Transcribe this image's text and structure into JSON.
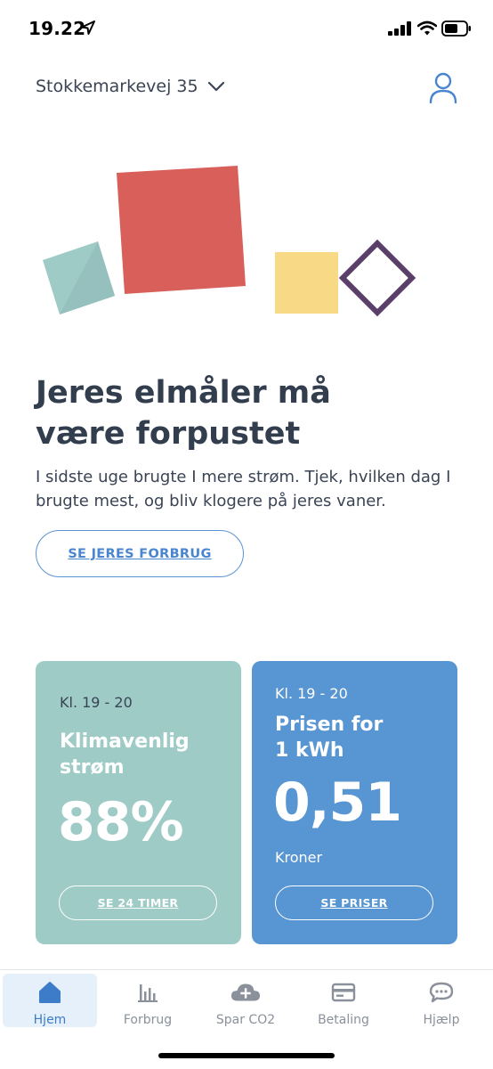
{
  "status_bar": {
    "time": "19.22",
    "icons": [
      "location-arrow-icon",
      "cellular-signal-icon",
      "wifi-icon",
      "battery-icon"
    ]
  },
  "header": {
    "address": "Stokkemarkevej 35",
    "address_icon": "chevron-down-icon",
    "profile_icon": "user-icon"
  },
  "hero": {
    "headline_line1": "Jeres elmåler må",
    "headline_line2": "være forpustet",
    "body_line1": "I sidste uge brugte I mere strøm. Tjek, hvilken dag I",
    "body_line2": "brugte mest, og bliv klogere på jeres vaner.",
    "button_label": "SE JERES FORBRUG"
  },
  "cards": {
    "climate": {
      "time": "Kl. 19 - 20",
      "title_line1": "Klimavenlig",
      "title_line2": "strøm",
      "value": "88%",
      "button_label": "SE 24 TIMER"
    },
    "price": {
      "time": "Kl. 19 - 20",
      "title_line1": "Prisen for",
      "title_line2": "1 kWh",
      "value": "0,51",
      "unit": "Kroner",
      "button_label": "SE PRISER"
    }
  },
  "tabbar": {
    "tabs": [
      {
        "label": "Hjem",
        "icon": "home-icon",
        "active": true
      },
      {
        "label": "Forbrug",
        "icon": "bar-chart-icon",
        "active": false
      },
      {
        "label": "Spar CO2",
        "icon": "cloud-plus-icon",
        "active": false
      },
      {
        "label": "Betaling",
        "icon": "credit-card-icon",
        "active": false
      },
      {
        "label": "Hjælp",
        "icon": "chat-bubble-icon",
        "active": false
      }
    ]
  },
  "colors": {
    "accent_blue": "#5895d3",
    "card_green": "#9fcbc7",
    "hero_red": "#d9605a",
    "hero_yellow": "#f7d986",
    "hero_purple": "#5b3f6b",
    "hero_teal": "#9fcbc7",
    "text_dark": "#323d4e"
  }
}
